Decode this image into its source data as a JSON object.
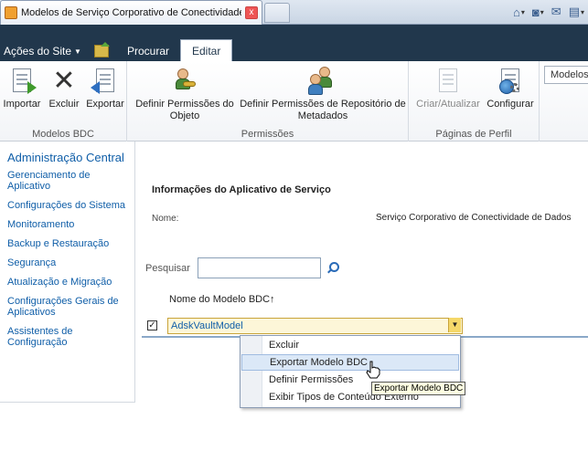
{
  "browser": {
    "tab_title": "Modelos de Serviço Corporativo de Conectividade de ...",
    "tab_close": "x",
    "commands": [
      {
        "icon": "home-icon",
        "glyph": "⌂"
      },
      {
        "icon": "rss-feed-icon",
        "glyph": "◙"
      },
      {
        "icon": "mail-icon",
        "glyph": "✉"
      },
      {
        "icon": "print-icon",
        "glyph": "▤"
      }
    ]
  },
  "ribbon_header": {
    "site_actions": "Ações do Site",
    "tabs": [
      {
        "label": "Procurar",
        "active": false
      },
      {
        "label": "Editar",
        "active": true
      }
    ]
  },
  "ribbon": {
    "groups": [
      {
        "label": "Modelos BDC",
        "buttons": [
          {
            "label": "Importar",
            "icon": "import-icon",
            "enabled": true
          },
          {
            "label": "Excluir",
            "icon": "delete-icon",
            "enabled": true
          },
          {
            "label": "Exportar",
            "icon": "export-icon",
            "enabled": true
          }
        ]
      },
      {
        "label": "Permissões",
        "buttons": [
          {
            "label": "Definir Permissões do Objeto",
            "icon": "set-object-permissions-icon",
            "enabled": true
          },
          {
            "label": "Definir Permissões de Repositório de Metadados",
            "icon": "set-metadata-store-permissions-icon",
            "enabled": true
          }
        ]
      },
      {
        "label": "Páginas de Perfil",
        "buttons": [
          {
            "label": "Criar/Atualizar",
            "icon": "create-update-icon",
            "enabled": false
          },
          {
            "label": "Configurar",
            "icon": "configure-icon",
            "enabled": true
          }
        ]
      }
    ],
    "view_selector": "Modelos"
  },
  "left_nav": {
    "title": "Administração Central",
    "items": [
      "Gerenciamento de Aplicativo",
      "Configurações do Sistema",
      "Monitoramento",
      "Backup e Restauração",
      "Segurança",
      "Atualização e Migração",
      "Configurações Gerais de Aplicativos",
      "Assistentes de Configuração"
    ]
  },
  "main": {
    "section_title": "Informações do Aplicativo de Serviço",
    "name_label": "Nome:",
    "name_value": "Serviço Corporativo de Conectividade de Dados",
    "search_label": "Pesquisar",
    "search_value": "",
    "column_header": "Nome do Modelo BDC↑",
    "rows": [
      {
        "name": "AdskVaultModel",
        "checked": true
      }
    ]
  },
  "context_menu": {
    "items": [
      {
        "label": "Excluir",
        "hover": false
      },
      {
        "label": "Exportar Modelo BDC",
        "hover": true
      },
      {
        "label": "Definir Permissões",
        "hover": false
      },
      {
        "label": "Exibir Tipos de Conteúdo Externo",
        "hover": false
      }
    ]
  },
  "tooltip": "Exportar Modelo BDC",
  "colors": {
    "header_bg": "#21374c",
    "link": "#0f5ea8",
    "menu_hover": "#dbe8f7"
  }
}
